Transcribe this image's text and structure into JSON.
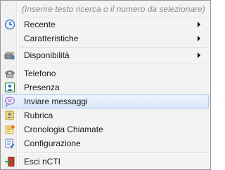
{
  "search": {
    "placeholder": "(Inserire testo ricerca o il numero da selezionare)"
  },
  "items": [
    {
      "label": "Recente",
      "icon": "clock-icon",
      "submenu": true
    },
    {
      "label": "Caratteristiche",
      "icon": "none",
      "submenu": true
    },
    {
      "label": "Disponibilità",
      "icon": "phone-user-icon",
      "submenu": true
    },
    {
      "label": "Telefono",
      "icon": "telephone-icon",
      "submenu": false
    },
    {
      "label": "Presenza",
      "icon": "presence-icon",
      "submenu": false
    },
    {
      "label": "Inviare messaggi",
      "icon": "message-bubble-icon",
      "submenu": false,
      "highlighted": true
    },
    {
      "label": "Rubrica",
      "icon": "address-book-icon",
      "submenu": false
    },
    {
      "label": "Cronologia Chiamate",
      "icon": "call-history-icon",
      "submenu": false
    },
    {
      "label": "Configurazione",
      "icon": "configuration-icon",
      "submenu": false
    },
    {
      "label": "Esci nCTI",
      "icon": "exit-icon",
      "submenu": false
    }
  ],
  "colors": {
    "highlight_border": "#a9c9ef",
    "highlight_fill": "#e3eefc",
    "menu_border": "#979797"
  }
}
